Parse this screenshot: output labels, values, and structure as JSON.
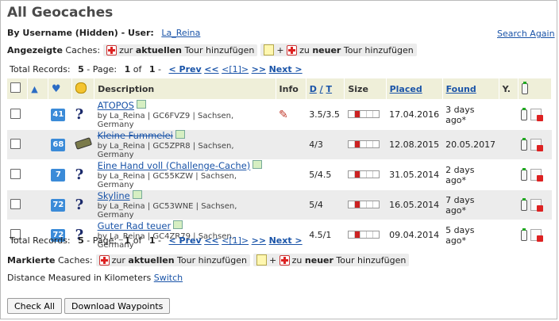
{
  "header": {
    "title": "All Geocaches"
  },
  "filter": {
    "label": "By Username (Hidden) - User:",
    "user": "La_Reina",
    "search_again": "Search Again"
  },
  "shown": {
    "label_bold": "Angezeigte",
    "label_rest": "Caches:",
    "add_current_pre": "zur",
    "add_current_bold": "aktuellen",
    "add_current_post": "Tour hinzufügen",
    "plus": "+",
    "add_new_pre": "zu",
    "add_new_bold": "neuer",
    "add_new_post": "Tour hinzufügen"
  },
  "paging": {
    "prefix": "Total Records:",
    "total": "5",
    "page_label": "- Page:",
    "page": "1",
    "of": "of",
    "pages": "1",
    "dash": "-",
    "prev": "< Prev",
    "first": "<<",
    "current": "<[1]>",
    "last": ">>",
    "next": "Next >"
  },
  "columns": {
    "description": "Description",
    "info": "Info",
    "d": "D",
    "slash": "/",
    "t": "T",
    "size": "Size",
    "placed": "Placed",
    "found": "Found",
    "y": "Y."
  },
  "rows": [
    {
      "fav": "41",
      "name": "ATOPOS",
      "owner": "by La_Reina | GC6FVZ9 | Sachsen, Germany",
      "info": "wrench",
      "dt": "3.5/3.5",
      "size": 1,
      "placed": "17.04.2016",
      "found": "3 days ago*",
      "type": "unknown"
    },
    {
      "fav": "68",
      "name": "Kleine Fummelei",
      "owner": "by La_Reina | GC5ZPR8 | Sachsen, Germany",
      "info": "",
      "dt": "4/3",
      "size": 1,
      "placed": "12.08.2015",
      "found": "20.05.2017",
      "type": "archived"
    },
    {
      "fav": "7",
      "name": "Eine Hand voll (Challenge-Cache)",
      "owner": "by La_Reina | GC55KZW | Sachsen, Germany",
      "info": "",
      "dt": "5/4.5",
      "size": 1,
      "placed": "31.05.2014",
      "found": "2 days ago*",
      "type": "unknown"
    },
    {
      "fav": "72",
      "name": "Skyline",
      "owner": "by La_Reina | GC53WNE | Sachsen, Germany",
      "info": "",
      "dt": "5/4",
      "size": 1,
      "placed": "16.05.2014",
      "found": "7 days ago*",
      "type": "unknown"
    },
    {
      "fav": "72",
      "name": "Guter Rad teuer",
      "owner": "by La_Reina | GC4ZR79 | Sachsen, Germany",
      "info": "",
      "dt": "4.5/1",
      "size": 1,
      "placed": "09.04.2014",
      "found": "5 days ago*",
      "type": "unknown"
    }
  ],
  "marked": {
    "label_bold": "Markierte",
    "label_rest": "Caches:",
    "add_current_pre": "zur",
    "add_current_bold": "aktuellen",
    "add_current_post": "Tour hinzufügen",
    "plus": "+",
    "add_new_pre": "zu",
    "add_new_bold": "neuer",
    "add_new_post": "Tour hinzufügen"
  },
  "distance": {
    "text": "Distance Measured in Kilometers",
    "switch": "Switch"
  },
  "buttons": {
    "check_all": "Check All",
    "download": "Download Waypoints"
  },
  "colors": {
    "header_bg": "#efefd9",
    "link": "#1a54a8",
    "fav_bg": "#3b8bd8",
    "even_row": "#ececec"
  }
}
